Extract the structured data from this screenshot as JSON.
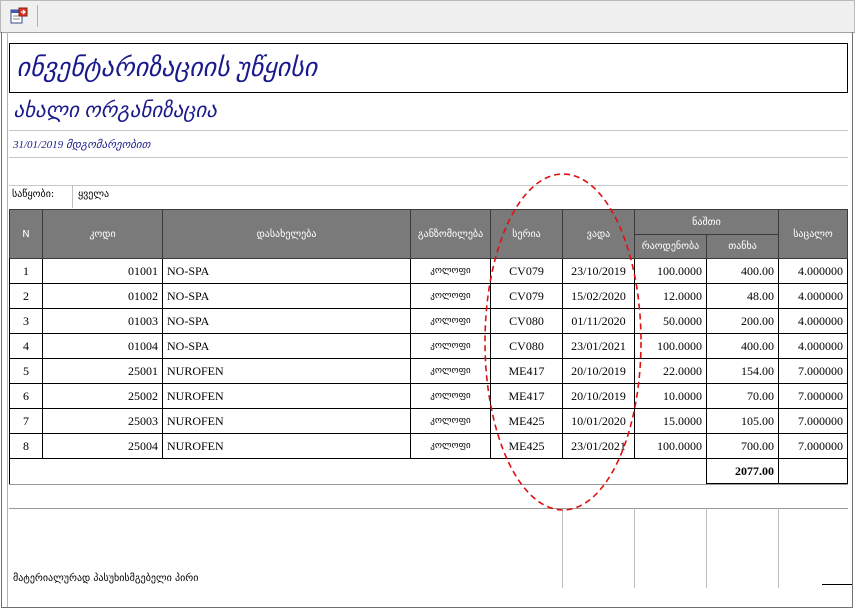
{
  "toolbar": {
    "export_icon": "export-icon"
  },
  "report": {
    "title": "ინვენტარიზაციის უწყისი",
    "organization": "ახალი ორგანიზაცია",
    "date_line": "31/01/2019  მდგომარეობით",
    "warehouse_label": "საწყობი:",
    "warehouse_value": "ყველა",
    "footer_label": "მატერიალურად პასუხისმგებელი პირი",
    "total": "2077.00"
  },
  "columns": {
    "n": "N",
    "code": "კოდი",
    "name": "დასახელება",
    "unit": "განზომილება",
    "series": "სერია",
    "expiry": "ვადა",
    "balance": "ნაშთი",
    "quantity": "რაოდენობა",
    "amount": "თანხა",
    "price": "საცალო"
  },
  "rows": [
    {
      "n": "1",
      "code": "01001",
      "name": "NO-SPA",
      "unit": "კოლოფი",
      "series": "CV079",
      "expiry": "23/10/2019",
      "quantity": "100.0000",
      "amount": "400.00",
      "price": "4.000000"
    },
    {
      "n": "2",
      "code": "01002",
      "name": "NO-SPA",
      "unit": "კოლოფი",
      "series": "CV079",
      "expiry": "15/02/2020",
      "quantity": "12.0000",
      "amount": "48.00",
      "price": "4.000000"
    },
    {
      "n": "3",
      "code": "01003",
      "name": "NO-SPA",
      "unit": "კოლოფი",
      "series": "CV080",
      "expiry": "01/11/2020",
      "quantity": "50.0000",
      "amount": "200.00",
      "price": "4.000000"
    },
    {
      "n": "4",
      "code": "01004",
      "name": "NO-SPA",
      "unit": "კოლოფი",
      "series": "CV080",
      "expiry": "23/01/2021",
      "quantity": "100.0000",
      "amount": "400.00",
      "price": "4.000000"
    },
    {
      "n": "5",
      "code": "25001",
      "name": "NUROFEN",
      "unit": "კოლოფი",
      "series": "ME417",
      "expiry": "20/10/2019",
      "quantity": "22.0000",
      "amount": "154.00",
      "price": "7.000000"
    },
    {
      "n": "6",
      "code": "25002",
      "name": "NUROFEN",
      "unit": "კოლოფი",
      "series": "ME417",
      "expiry": "20/10/2019",
      "quantity": "10.0000",
      "amount": "70.00",
      "price": "7.000000"
    },
    {
      "n": "7",
      "code": "25003",
      "name": "NUROFEN",
      "unit": "კოლოფი",
      "series": "ME425",
      "expiry": "10/01/2020",
      "quantity": "15.0000",
      "amount": "105.00",
      "price": "7.000000"
    },
    {
      "n": "8",
      "code": "25004",
      "name": "NUROFEN",
      "unit": "კოლოფი",
      "series": "ME425",
      "expiry": "23/01/2021",
      "quantity": "100.0000",
      "amount": "700.00",
      "price": "7.000000"
    }
  ],
  "colors": {
    "header_bg": "#7a7a7a",
    "title_text": "#1a1a8c",
    "annotation": "#e01010"
  }
}
